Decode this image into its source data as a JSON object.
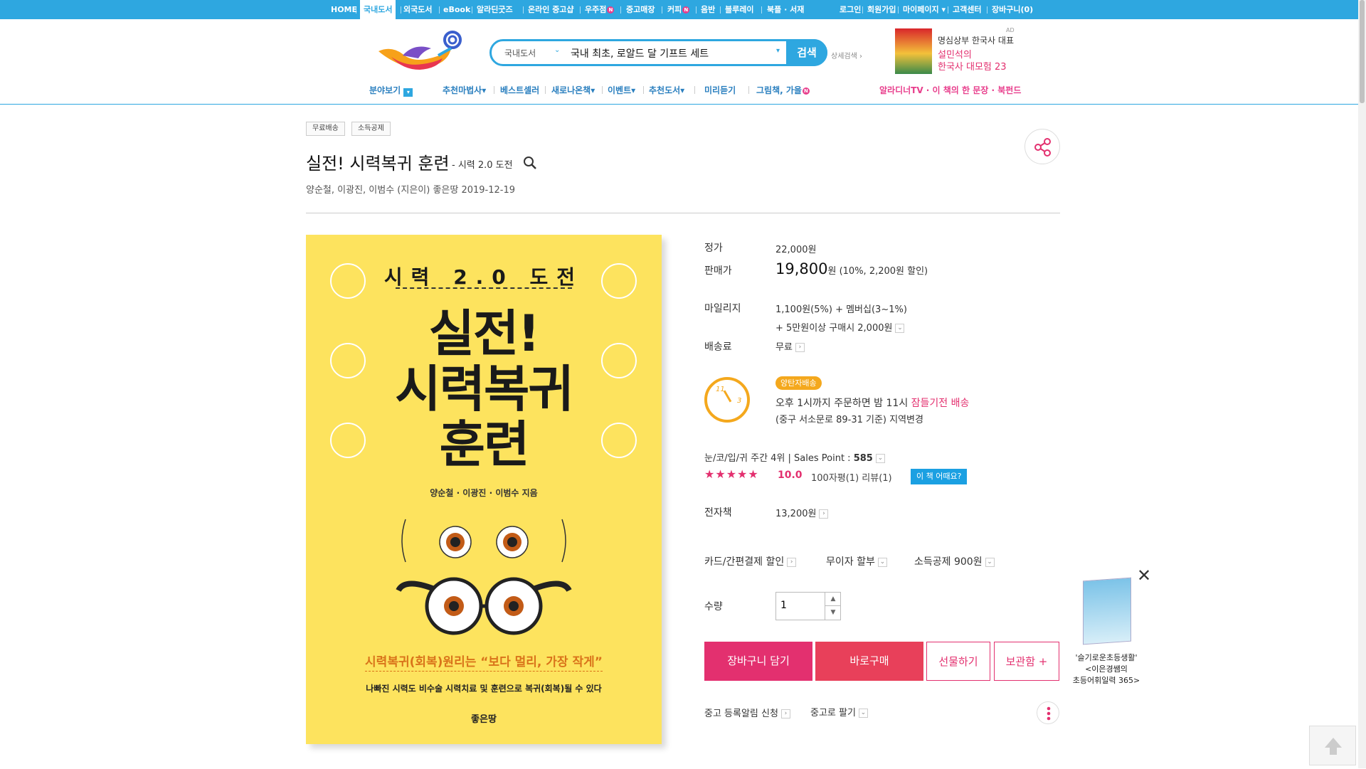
{
  "topnav": {
    "items": [
      "HOME",
      "국내도서",
      "외국도서",
      "eBook",
      "알라딘굿즈",
      "온라인 중고샵",
      "우주점",
      "중고매장",
      "커피",
      "음반",
      "블루레이",
      "북플 · 서재"
    ],
    "right": [
      "로그인",
      "회원가입",
      "마이페이지",
      "고객센터",
      "장바구니(0)"
    ],
    "new_badge": "N"
  },
  "search": {
    "category": "국내도서",
    "value": "국내 최초, 로알드 달 기프트 세트",
    "button": "검색",
    "advanced": "상세검색"
  },
  "ad": {
    "label": "AD",
    "line1": "명심상부 한국사 대표",
    "line2": "설민석의",
    "line3": "한국사 대모험 23"
  },
  "subnav": {
    "items": [
      "분야보기",
      "추천마법사",
      "베스트셀러",
      "새로나온책",
      "이벤트",
      "추천도서",
      "미리듣기",
      "그림책, 가을"
    ],
    "right": "알라디너TV · 이 책의 한 문장 · 북펀드"
  },
  "product": {
    "tags": [
      "무료배송",
      "소득공제"
    ],
    "title": "실전! 시력복귀 훈련",
    "subtitle": "- 시력 2.0 도전",
    "authors": "양순철,   이광진,   이범수 (지은이)   좋은땅   2019-12-19"
  },
  "cover": {
    "top": "시력 2.0 도전",
    "main1": "실전!",
    "main2": "시력복귀",
    "main3": "훈련",
    "authors": "양순철 · 이광진 · 이범수 지음",
    "tagline": "시력복귀(회복)원리는 “보다 멀리, 가장 작게”",
    "sub": "나빠진 시력도 비수술 시력치료 및 훈련으로 복귀(회복)될 수 있다",
    "publisher": "좋은땅"
  },
  "price": {
    "list_label": "정가",
    "list_value": "22,000원",
    "sale_label": "판매가",
    "sale_value": "19,800",
    "sale_unit": "원",
    "sale_discount": "(10%, 2,200원 할인)",
    "mileage_label": "마일리지",
    "mileage_value": "1,100원(5%) + 멤버십(3~1%)",
    "mileage_extra": "+ 5만원이상 구매시 2,000원",
    "shipping_label": "배송료",
    "shipping_value": "무료"
  },
  "delivery": {
    "badge": "양탄자배송",
    "line1": "오후 1시까지 주문하면 밤 11시",
    "line1_highlight": "잠들기전 배송",
    "line2": "(중구 서소문로 89-31 기준) 지역변경",
    "clock_a": "11",
    "clock_b": "3"
  },
  "rank": {
    "text": "눈/코/입/귀 주간 4위  |  Sales Point :",
    "point": "585",
    "rating": "10.0",
    "review_text": "100자평(1)   리뷰(1)",
    "ask_button": "이 책 어때요?"
  },
  "ebook": {
    "label": "전자책",
    "value": "13,200원"
  },
  "benefits": [
    "카드/간편결제 할인",
    "무이자 할부",
    "소득공제 900원"
  ],
  "quantity": {
    "label": "수량",
    "value": "1"
  },
  "actions": {
    "cart": "장바구니 담기",
    "buy": "바로구매",
    "gift": "선물하기",
    "save": "보관함 +"
  },
  "used": {
    "notify": "중고 등록알림 신청",
    "sell": "중고로 팔기"
  },
  "side_ad": {
    "line1": "'슬기로운초등생활'",
    "line2": "<이은경쌤의",
    "line3": "초등어휘일력 365>"
  },
  "colors": {
    "brand": "#2ea7e0",
    "pink": "#e3306f",
    "cover": "#fde35e",
    "orange": "#f4a81d"
  }
}
